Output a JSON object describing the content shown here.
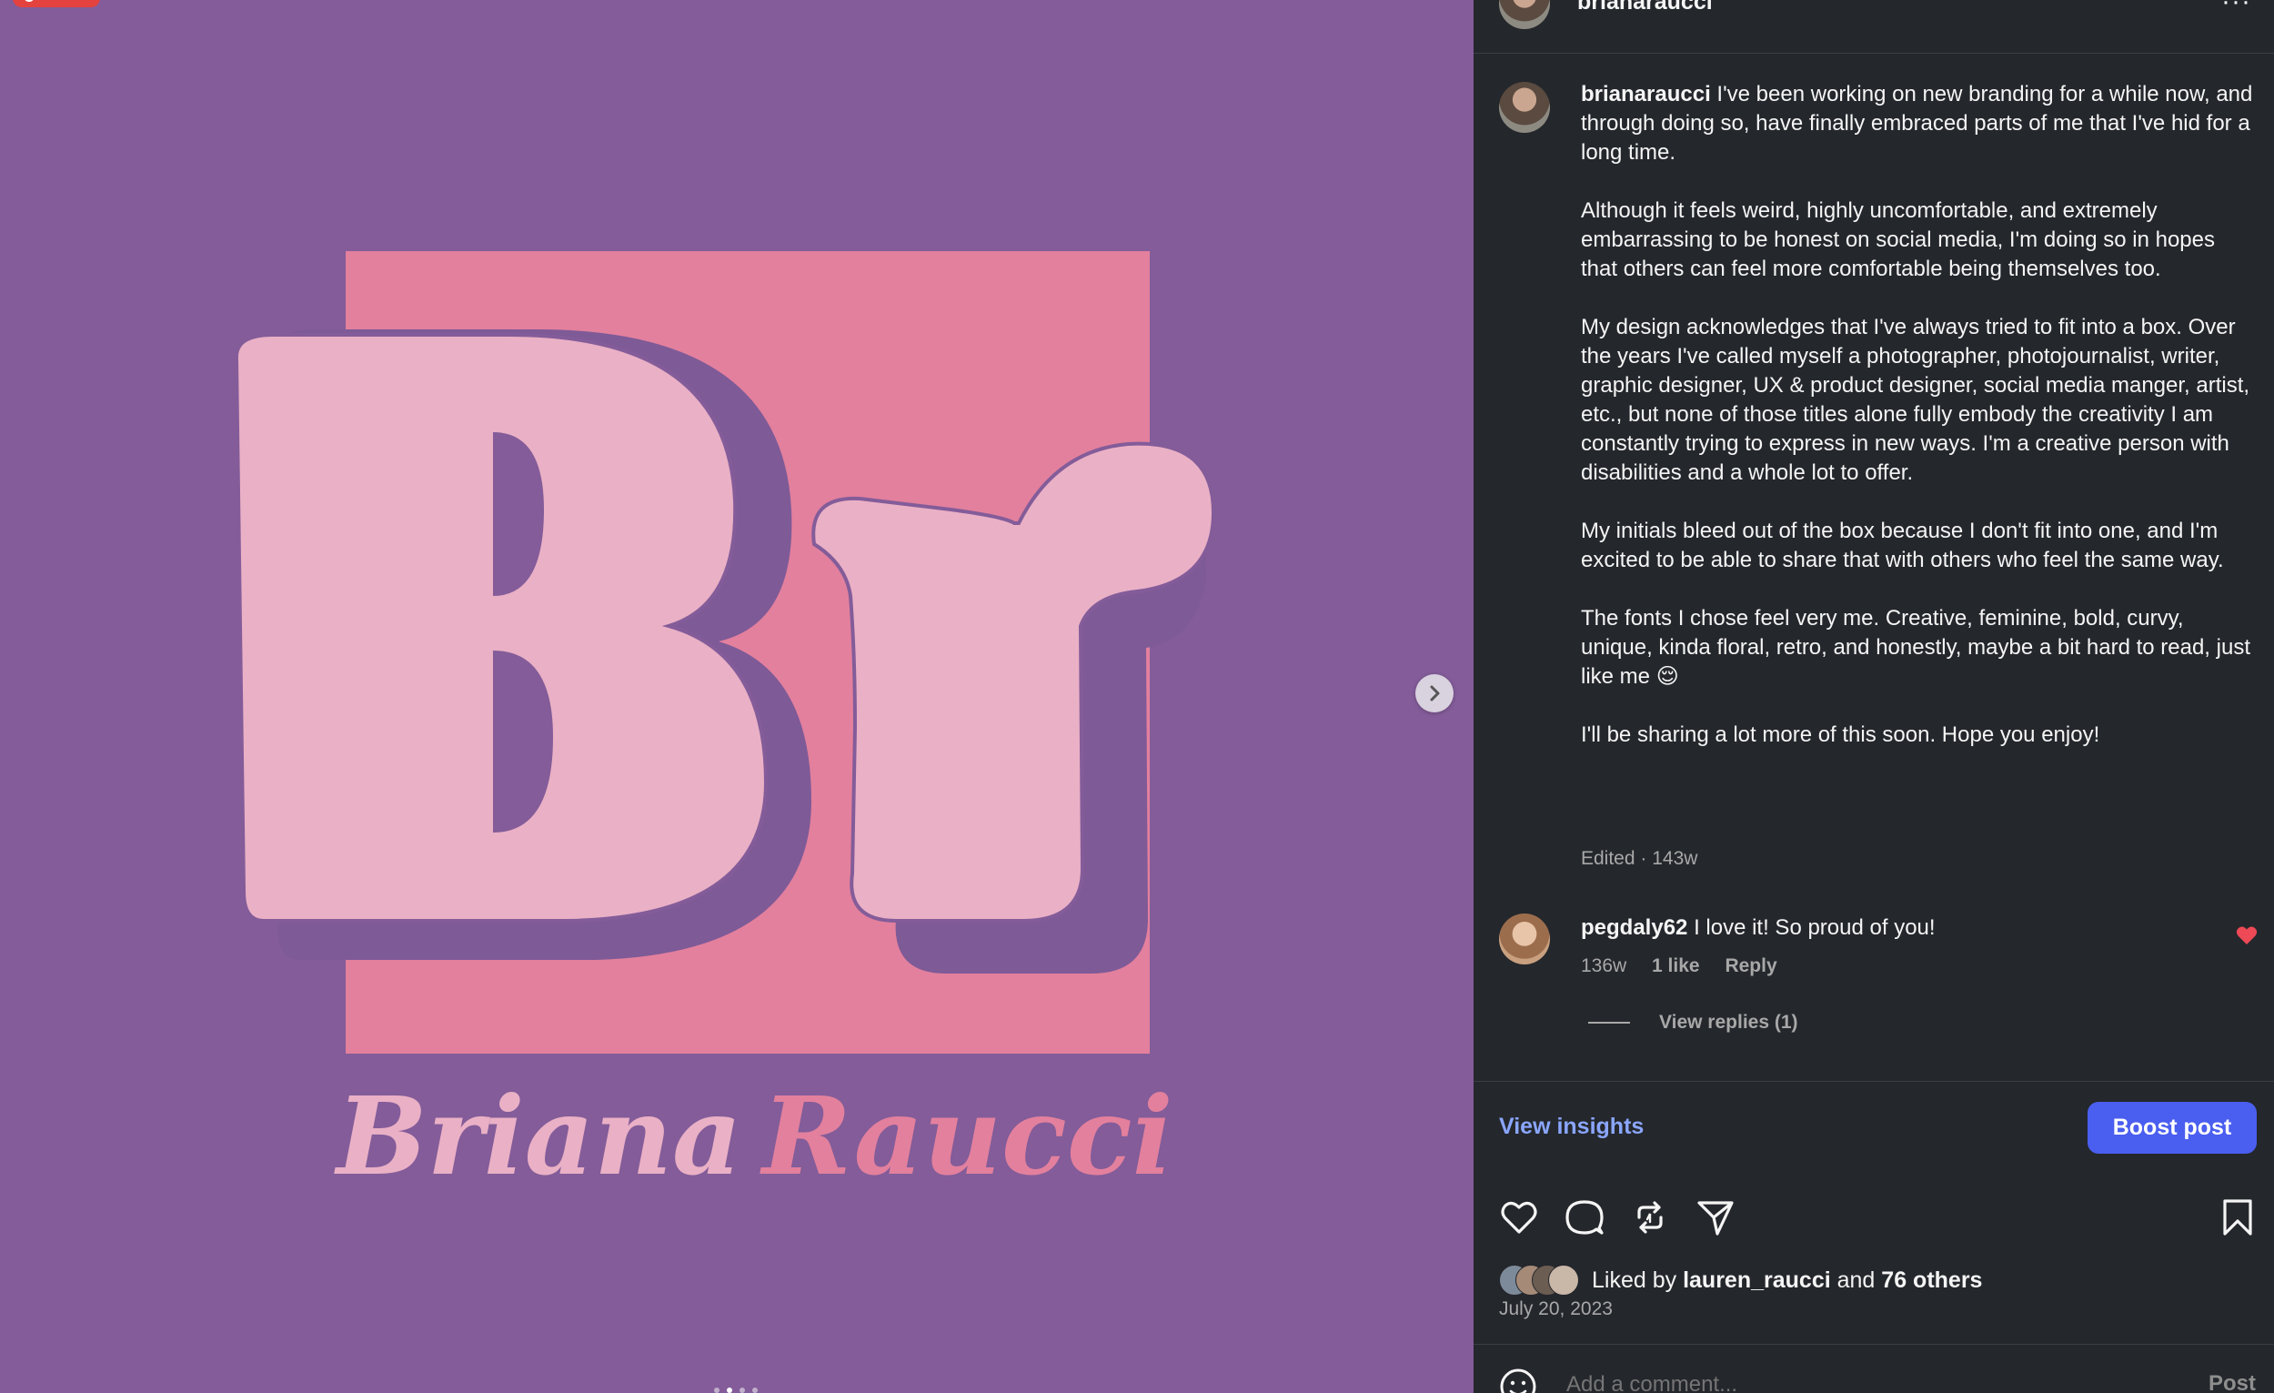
{
  "post": {
    "username": "brianaraucci",
    "caption_paragraphs": [
      "I've been working on new branding for a while now, and through doing so, have finally embraced parts of me that I've hid for a long time.",
      "Although it feels weird, highly uncomfortable, and extremely embarrassing to be honest on social media, I'm doing so in hopes that others can feel more comfortable being themselves too.",
      "My design acknowledges that I've always tried to fit into a box. Over the years I've called myself a photographer, photojournalist, writer, graphic designer, UX & product designer, social media manger, artist, etc., but none of those titles alone fully embody the creativity I am constantly trying to express in new ways. I'm a creative person with disabilities and a whole lot to offer.",
      "My initials bleed out of the box because I don't fit into one, and I'm excited to be able to share that with others who feel the same way.",
      "The fonts I chose feel very me. Creative, feminine, bold, curvy, unique, kinda floral, retro, and honestly, maybe a bit hard to read, just like me 😌",
      "I'll be sharing a lot more of this soon. Hope you enjoy!"
    ],
    "caption_meta": "Edited · 143w"
  },
  "media": {
    "logo_initials": "Br",
    "logo_first_name": "Briana",
    "logo_last_name": "Raucci",
    "background_color": "#835c99",
    "box_color": "#e3809d",
    "letter_color": "#eab0c5"
  },
  "comment": {
    "username": "pegdaly62",
    "text": "I love it! So proud of you!",
    "time": "136w",
    "likes": "1 like",
    "reply_label": "Reply",
    "view_replies": "View replies (1)"
  },
  "actions": {
    "view_insights": "View insights",
    "boost_post": "Boost post"
  },
  "likes": {
    "prefix": "Liked by",
    "user": "lauren_raucci",
    "joiner": "and",
    "others": "76 others"
  },
  "date": "July 20, 2023",
  "add_comment": {
    "placeholder": "Add a comment...",
    "post_label": "Post"
  },
  "colors": {
    "panel_bg": "#24272c",
    "accent_link": "#8aa6ff",
    "boost_button": "#4a5ef0",
    "heart_liked": "#ed4956"
  },
  "icons": [
    "like-icon",
    "comment-icon",
    "repost-icon",
    "share-icon",
    "save-icon",
    "more-icon",
    "chevron-right-icon",
    "emoji-icon",
    "heart-icon"
  ]
}
